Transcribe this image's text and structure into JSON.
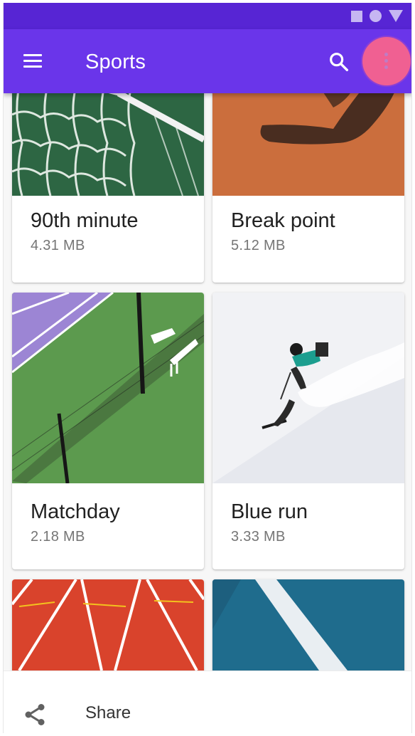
{
  "app_bar": {
    "title": "Sports",
    "menu_icon": "hamburger-menu-icon",
    "search_icon": "search-icon",
    "more_icon": "more-vert-icon",
    "color": "#6a35ea",
    "status_bar_color": "#5725d4",
    "highlight_color": "#f06092"
  },
  "status_bar": {
    "icons": [
      "square-icon",
      "circle-icon",
      "triangle-icon"
    ]
  },
  "cards": [
    {
      "name": "90th minute",
      "size": "4.31 MB",
      "image": "soccer-goal-net-photo"
    },
    {
      "name": "Break point",
      "size": "5.12 MB",
      "image": "clay-court-shadow-photo"
    },
    {
      "name": "Matchday",
      "size": "2.18 MB",
      "image": "tennis-court-fence-photo"
    },
    {
      "name": "Blue run",
      "size": "3.33 MB",
      "image": "skier-slope-photo"
    },
    {
      "name": "",
      "size": "",
      "image": "running-track-lanes-photo"
    },
    {
      "name": "",
      "size": "",
      "image": "blue-court-line-photo"
    }
  ],
  "bottom_sheet": {
    "share_label": "Share",
    "share_icon": "share-icon"
  }
}
